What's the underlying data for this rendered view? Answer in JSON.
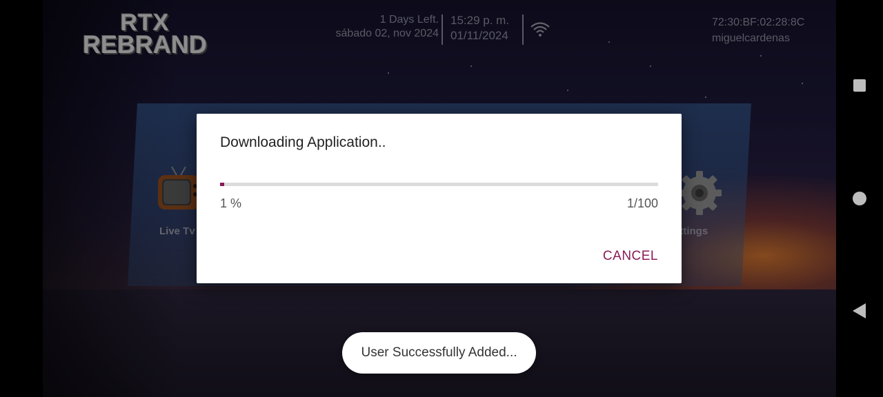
{
  "header": {
    "logo_line1": "RTX",
    "logo_line2": "REBRAND",
    "days_left": "1 Days Left.",
    "date_long": "sábado 02, nov 2024",
    "time": "15:29 p. m.",
    "date_short": "01/11/2024",
    "mac_address": "72:30:BF:02:28:8C",
    "username": "miguelcardenas",
    "wifi_icon": "wifi-icon"
  },
  "menu": {
    "live_tv_label": "Live Tv",
    "settings_label": "ettings"
  },
  "dialog": {
    "title": "Downloading Application..",
    "progress_fraction": 0.01,
    "progress_percent_text": "1 %",
    "progress_count_text": "1/100",
    "cancel_label": "CANCEL",
    "accent_color": "#8a1a56"
  },
  "toast": {
    "message": "User Successfully Added..."
  },
  "navbar": {
    "recent_icon": "recent-apps-icon",
    "home_icon": "home-icon",
    "back_icon": "back-icon"
  }
}
